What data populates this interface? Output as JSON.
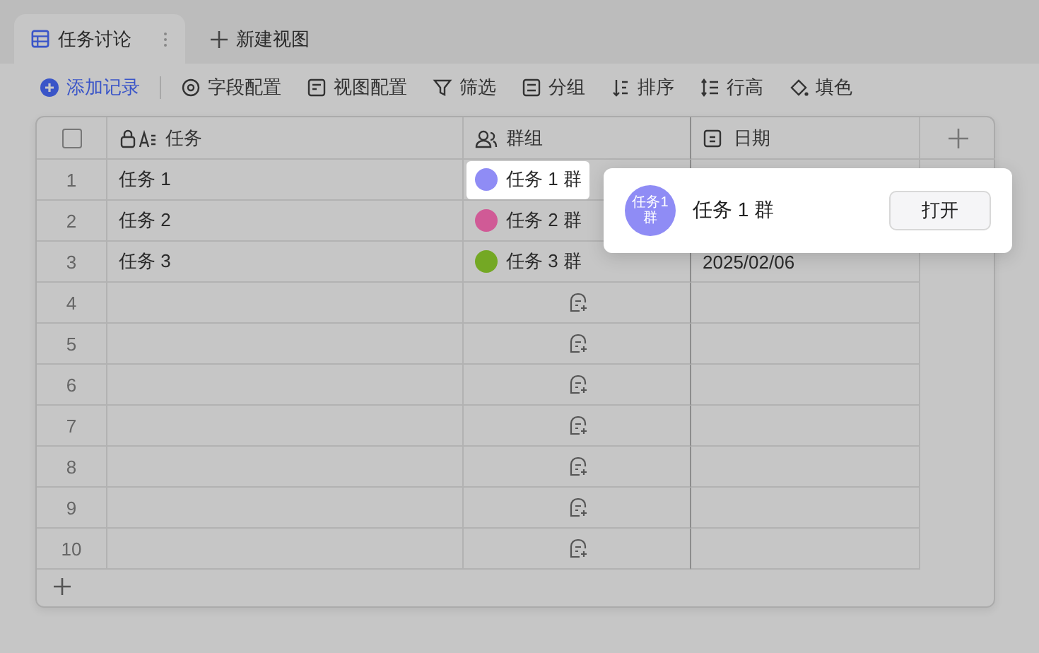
{
  "tabs": [
    {
      "label": "任务讨论",
      "selected": true
    }
  ],
  "new_view_button": "新建视图",
  "toolbar": [
    {
      "label": "添加记录",
      "kind": "primary"
    },
    {
      "label": "字段配置",
      "kind": "fields"
    },
    {
      "label": "视图配置",
      "kind": "view"
    },
    {
      "label": "筛选",
      "kind": "filter"
    },
    {
      "label": "分组",
      "kind": "group"
    },
    {
      "label": "排序",
      "kind": "sort"
    },
    {
      "label": "行高",
      "kind": "height"
    },
    {
      "label": "填色",
      "kind": "fill"
    }
  ],
  "table": {
    "select_all": {
      "checked": false
    },
    "columns": [
      {
        "label": "任务",
        "kind": "text"
      },
      {
        "label": "群组",
        "kind": "group"
      },
      {
        "label": "日期",
        "kind": "date"
      }
    ],
    "rows": [
      {
        "number": "1",
        "task": "任务 1",
        "group": {
          "name": "任务 1 群",
          "color": "#8f8cf5",
          "selected": true
        }
      },
      {
        "number": "2",
        "task": "任务 2",
        "group": {
          "name": "任务 2 群",
          "color": "#d05a96",
          "selected": false
        }
      },
      {
        "number": "3",
        "task": "任务 3",
        "group": {
          "name": "任务 3 群",
          "color": "#74a824",
          "selected": false
        },
        "date": "2025/02/06"
      },
      {
        "number": "4"
      },
      {
        "number": "5"
      },
      {
        "number": "6"
      },
      {
        "number": "7"
      },
      {
        "number": "8"
      },
      {
        "number": "9"
      },
      {
        "number": "10"
      }
    ]
  },
  "popup": {
    "avatar_text": "任务1 群",
    "color": "#8f8cf5",
    "name": "任务 1 群",
    "button": "打开"
  }
}
